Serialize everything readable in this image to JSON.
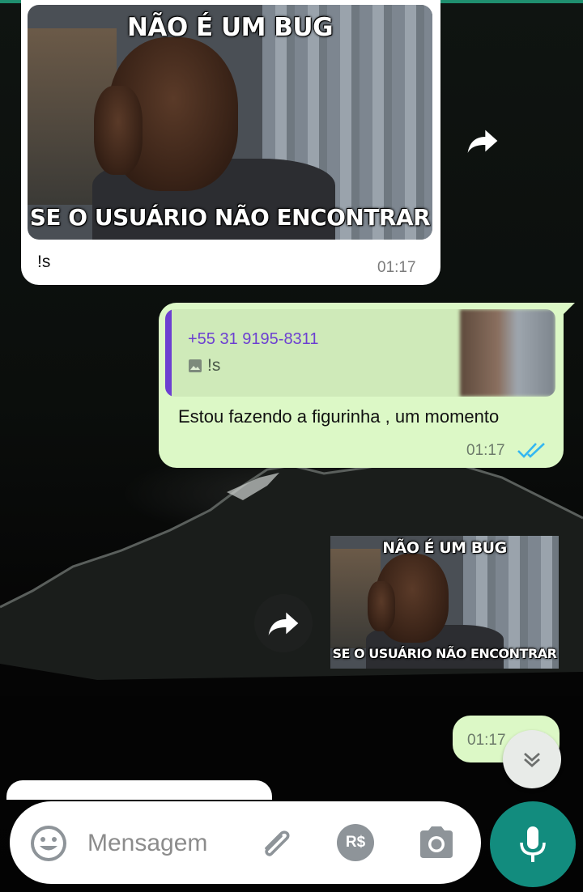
{
  "messages": {
    "incoming_image": {
      "meme_top": "NÃO É UM BUG",
      "meme_bottom": "SE O USUÁRIO NÃO ENCONTRAR",
      "caption": "!s",
      "time": "01:17"
    },
    "outgoing_reply": {
      "quoted_sender": "+55 31 9195-8311",
      "quoted_text": "!s",
      "text": "Estou fazendo a figurinha , um momento",
      "time": "01:17",
      "status": "read"
    },
    "sticker": {
      "meme_top": "NÃO É UM BUG",
      "meme_bottom": "SE O USUÁRIO NÃO ENCONTRAR"
    },
    "outgoing_small": {
      "time": "01:17",
      "status": "delivered"
    }
  },
  "composer": {
    "placeholder": "Mensagem",
    "payment_label": "R$"
  },
  "colors": {
    "outgoing_bubble": "#dcf8c6",
    "accent": "#128c7e",
    "quote_bar": "#6c3fd1",
    "read_ticks": "#34b7f1"
  },
  "icons": [
    "forward-icon",
    "emoji-icon",
    "attach-icon",
    "camera-icon",
    "mic-icon",
    "chevron-down-icon",
    "image-icon",
    "double-check-icon"
  ]
}
